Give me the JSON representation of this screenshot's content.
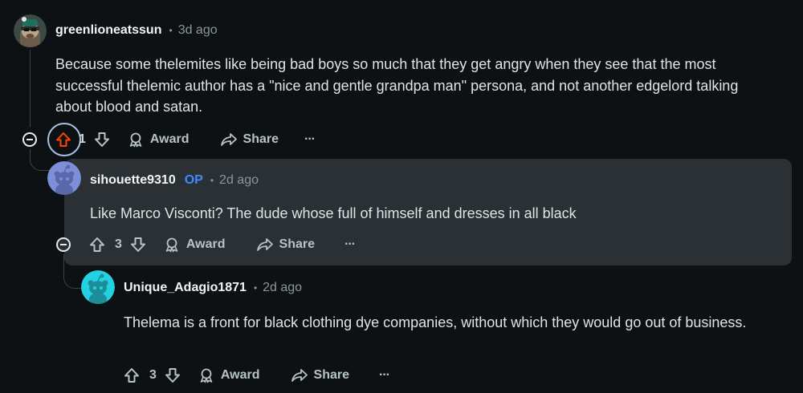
{
  "comments": [
    {
      "username": "greenlioneatssun",
      "separator": "•",
      "time": "3d ago",
      "body": "Because some thelemites like being bad boys so much that they get angry when they see that the most successful thelemic author has a \"nice and gentle grandpa man\" persona, and not another edgelord talking about blood and satan.",
      "votes": "1",
      "award_label": "Award",
      "share_label": "Share",
      "more_label": "···"
    },
    {
      "username": "sihouette9310",
      "op_badge": "OP",
      "separator": "•",
      "time": "2d ago",
      "body": "Like Marco Visconti? The dude whose full of himself and dresses in all black",
      "votes": "3",
      "award_label": "Award",
      "share_label": "Share",
      "more_label": "···"
    },
    {
      "username": "Unique_Adagio1871",
      "separator": "•",
      "time": "2d ago",
      "body": "Thelema is a front for black clothing dye companies, without which they would go out of business.",
      "votes": "3",
      "award_label": "Award",
      "share_label": "Share",
      "more_label": "···"
    }
  ],
  "colors": {
    "background": "#0e1113",
    "highlight": "#2a3033",
    "upvoted": "#ff4500",
    "op": "#3d8bff",
    "avatar_blue": "#7d8fd6",
    "avatar_cyan": "#24d1e0"
  }
}
